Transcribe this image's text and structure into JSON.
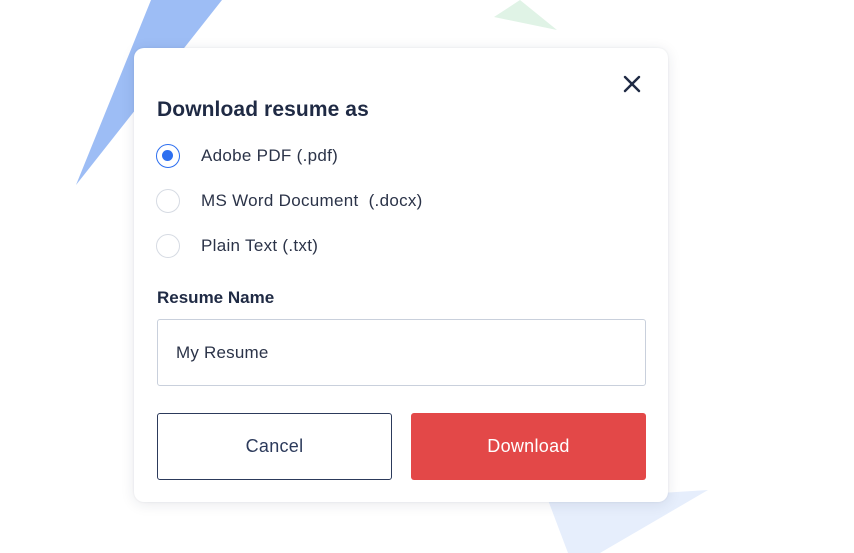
{
  "dialog": {
    "title": "Download resume as",
    "options": [
      {
        "label": "Adobe PDF (.pdf)",
        "selected": true
      },
      {
        "label": "MS Word Document  (.docx)",
        "selected": false
      },
      {
        "label": "Plain Text (.txt)",
        "selected": false
      }
    ],
    "name_field": {
      "label": "Resume Name",
      "value": "My Resume"
    },
    "cancel_label": "Cancel",
    "download_label": "Download"
  },
  "icons": {
    "close": "close-icon"
  },
  "colors": {
    "accent": "#2d6ff0",
    "primary_button": "#e34848",
    "text": "#1f2a44",
    "decor_blue": "#9dbdf5",
    "decor_green": "#e0f3e6",
    "decor_light_blue": "#e6eefc"
  }
}
